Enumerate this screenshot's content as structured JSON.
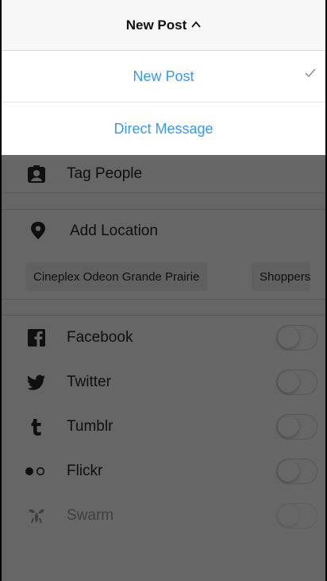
{
  "header": {
    "title": "New Post"
  },
  "dropdown": {
    "items": [
      {
        "label": "New Post",
        "selected": true
      },
      {
        "label": "Direct Message",
        "selected": false
      }
    ]
  },
  "options": {
    "tag_people": "Tag People",
    "add_location": "Add Location",
    "location_suggestions": [
      "Cineplex Odeon Grande Prairie",
      "Shoppers"
    ]
  },
  "share_targets": [
    {
      "name": "Facebook",
      "icon": "facebook-icon",
      "enabled": false
    },
    {
      "name": "Twitter",
      "icon": "twitter-icon",
      "enabled": false
    },
    {
      "name": "Tumblr",
      "icon": "tumblr-icon",
      "enabled": false
    },
    {
      "name": "Flickr",
      "icon": "flickr-icon",
      "enabled": false
    },
    {
      "name": "Swarm",
      "icon": "swarm-icon",
      "enabled": false
    }
  ],
  "colors": {
    "accent": "#3897f0",
    "text": "#262626",
    "overlay": "rgba(0,0,0,0.6)"
  }
}
